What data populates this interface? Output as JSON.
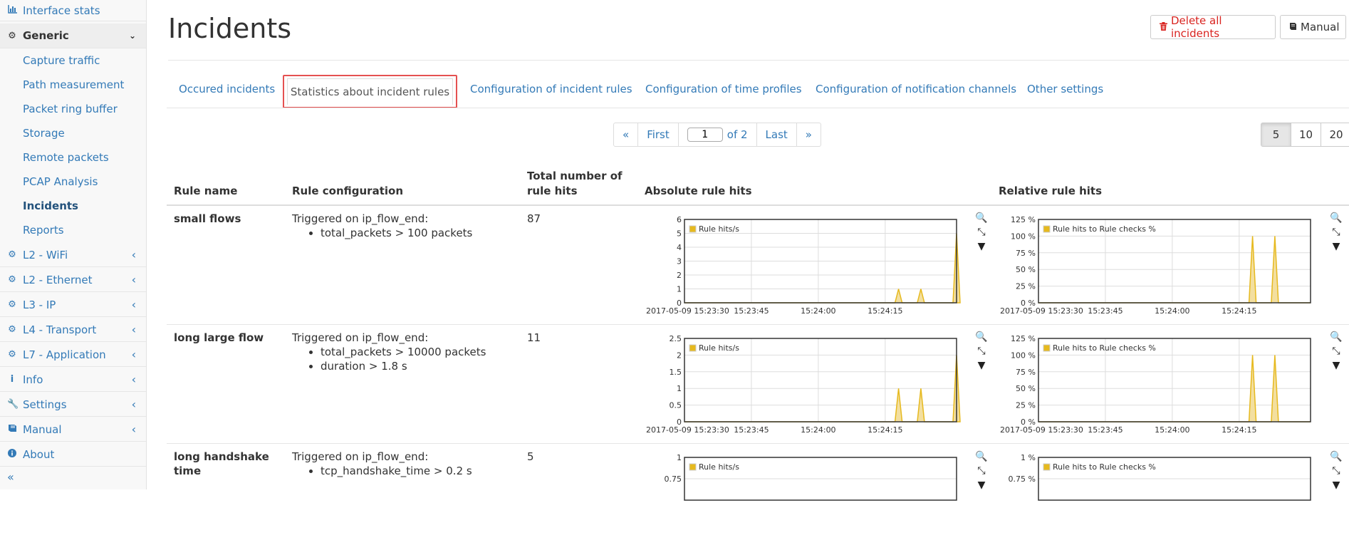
{
  "sidebar": {
    "top_link": "Interface stats",
    "group_generic": "Generic",
    "sub_items": [
      "Capture traffic",
      "Path measurement",
      "Packet ring buffer",
      "Storage",
      "Remote packets",
      "PCAP Analysis",
      "Incidents",
      "Reports"
    ],
    "groups": [
      "L2 - WiFi",
      "L2 - Ethernet",
      "L3 - IP",
      "L4 - Transport",
      "L7 - Application",
      "Info",
      "Settings",
      "Manual"
    ],
    "about": "About",
    "collapse": "«"
  },
  "header": {
    "title": "Incidents",
    "delete_all": "Delete all incidents",
    "manual": "Manual"
  },
  "tabs": [
    "Occured incidents",
    "Statistics about incident rules",
    "Configuration of incident rules",
    "Configuration of time profiles",
    "Configuration of notification channels",
    "Other settings"
  ],
  "pagination": {
    "prev": "«",
    "first": "First",
    "current": "1",
    "of_label": "of 2",
    "last": "Last",
    "next": "»",
    "sizes": [
      "5",
      "10",
      "20"
    ],
    "selected_size": "5"
  },
  "table": {
    "headers": [
      "Rule name",
      "Rule configuration",
      "Total number of rule hits",
      "Absolute rule hits",
      "Relative rule hits"
    ],
    "rows": [
      {
        "name": "small flows",
        "trigger": "Triggered on ip_flow_end:",
        "conditions": [
          "total_packets > 100 packets"
        ],
        "total": "87"
      },
      {
        "name": "long large flow",
        "trigger": "Triggered on ip_flow_end:",
        "conditions": [
          "total_packets > 10000 packets",
          "duration > 1.8 s"
        ],
        "total": "11"
      },
      {
        "name": "long handshake time",
        "trigger": "Triggered on ip_flow_end:",
        "conditions": [
          "tcp_handshake_time > 0.2 s"
        ],
        "total": "5"
      }
    ]
  },
  "colors": {
    "series_line": "#e6b91e",
    "series_fill": "#f3dfa0",
    "link": "#337ab7",
    "danger": "#d9231f",
    "highlight": "#e55151"
  },
  "chart_data": [
    {
      "type": "area",
      "row": "small flows",
      "title": "Absolute rule hits",
      "legend": "Rule hits/s",
      "x_ticks": [
        "2017-05-09 15:23:30",
        "15:23:45",
        "15:24:00",
        "15:24:15"
      ],
      "y_ticks": [
        "0",
        "1",
        "2",
        "3",
        "4",
        "5",
        "6"
      ],
      "ylim": [
        0,
        6
      ],
      "x": [
        "15:23:30",
        "15:24:18",
        "15:24:23",
        "15:24:31"
      ],
      "y": [
        0,
        1,
        1,
        5
      ]
    },
    {
      "type": "area",
      "row": "small flows",
      "title": "Relative rule hits",
      "legend": "Rule hits to Rule checks %",
      "x_ticks": [
        "2017-05-09 15:23:30",
        "15:23:45",
        "15:24:00",
        "15:24:15"
      ],
      "y_ticks": [
        "0 %",
        "25 %",
        "50 %",
        "75 %",
        "100 %",
        "125 %"
      ],
      "ylim": [
        0,
        125
      ],
      "x": [
        "15:23:30",
        "15:24:18",
        "15:24:23",
        "15:24:31"
      ],
      "y": [
        0,
        100,
        100,
        0
      ]
    },
    {
      "type": "area",
      "row": "long large flow",
      "title": "Absolute rule hits",
      "legend": "Rule hits/s",
      "x_ticks": [
        "2017-05-09 15:23:30",
        "15:23:45",
        "15:24:00",
        "15:24:15"
      ],
      "y_ticks": [
        "0",
        "0.5",
        "1",
        "1.5",
        "2",
        "2.5"
      ],
      "ylim": [
        0,
        2.5
      ],
      "x": [
        "15:23:30",
        "15:24:18",
        "15:24:23",
        "15:24:31"
      ],
      "y": [
        0,
        1,
        1,
        2
      ]
    },
    {
      "type": "area",
      "row": "long large flow",
      "title": "Relative rule hits",
      "legend": "Rule hits to Rule checks %",
      "x_ticks": [
        "2017-05-09 15:23:30",
        "15:23:45",
        "15:24:00",
        "15:24:15"
      ],
      "y_ticks": [
        "0 %",
        "25 %",
        "50 %",
        "75 %",
        "100 %",
        "125 %"
      ],
      "ylim": [
        0,
        125
      ],
      "x": [
        "15:23:30",
        "15:24:18",
        "15:24:23",
        "15:24:31"
      ],
      "y": [
        0,
        100,
        100,
        0
      ]
    },
    {
      "type": "area",
      "row": "long handshake time",
      "title": "Absolute rule hits",
      "legend": "Rule hits/s",
      "y_ticks": [
        "1",
        "0.75"
      ],
      "ylim": [
        0,
        1
      ]
    },
    {
      "type": "area",
      "row": "long handshake time",
      "title": "Relative rule hits",
      "legend": "Rule hits to Rule checks %",
      "y_ticks": [
        "1 %",
        "0.75 %"
      ],
      "ylim": [
        0,
        1
      ]
    }
  ]
}
